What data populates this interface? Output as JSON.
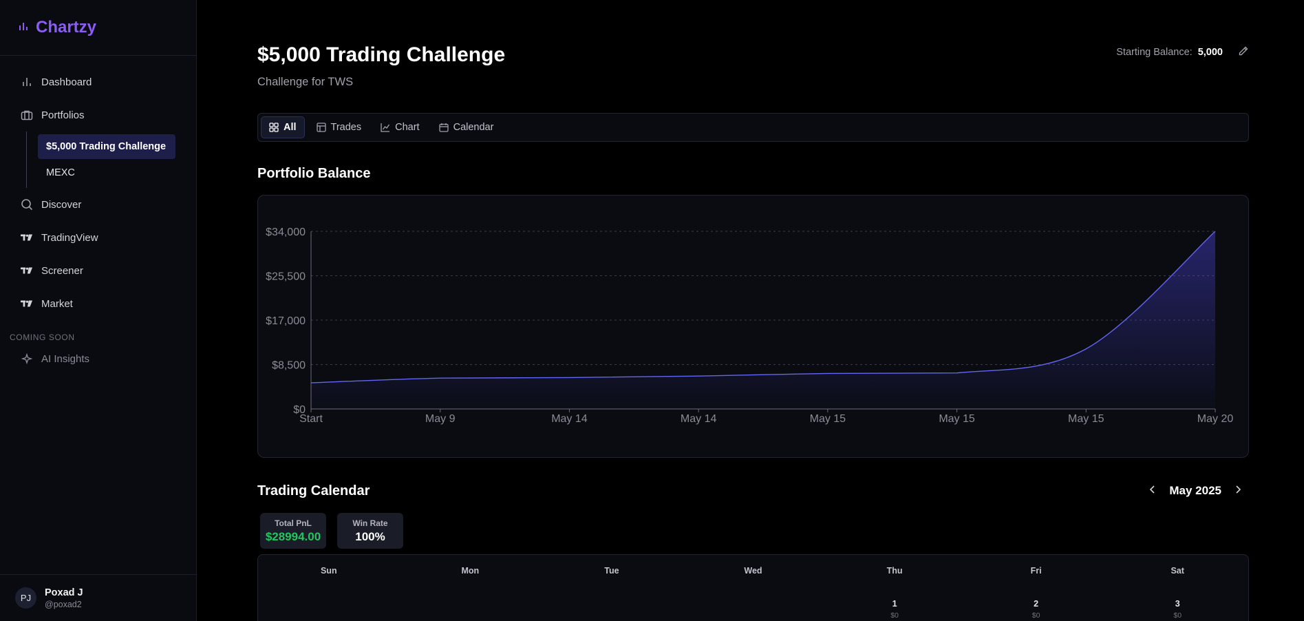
{
  "app": {
    "name": "Chartzy"
  },
  "sidebar": {
    "items": [
      {
        "label": "Dashboard",
        "icon": "bar-chart-icon"
      },
      {
        "label": "Portfolios",
        "icon": "briefcase-icon"
      },
      {
        "label": "Discover",
        "icon": "search-icon"
      },
      {
        "label": "TradingView",
        "icon": "tradingview-icon"
      },
      {
        "label": "Screener",
        "icon": "tradingview-icon"
      },
      {
        "label": "Market",
        "icon": "tradingview-icon"
      }
    ],
    "portfolios": [
      {
        "label": "$5,000 Trading Challenge",
        "active": true
      },
      {
        "label": "MEXC",
        "active": false
      }
    ],
    "coming_soon_label": "COMING SOON",
    "coming_soon_items": [
      {
        "label": "AI Insights",
        "icon": "sparkle-icon"
      }
    ]
  },
  "user": {
    "initials": "PJ",
    "name": "Poxad J",
    "handle": "@poxad2"
  },
  "header": {
    "title": "$5,000 Trading Challenge",
    "subtitle": "Challenge for TWS",
    "starting_balance_label": "Starting Balance:",
    "starting_balance_value": "5,000"
  },
  "tabs": [
    {
      "label": "All",
      "icon": "grid-icon",
      "active": true
    },
    {
      "label": "Trades",
      "icon": "table-icon",
      "active": false
    },
    {
      "label": "Chart",
      "icon": "line-chart-icon",
      "active": false
    },
    {
      "label": "Calendar",
      "icon": "calendar-icon",
      "active": false
    }
  ],
  "balance_section": {
    "title": "Portfolio Balance"
  },
  "chart_data": {
    "type": "area",
    "x": [
      "Start",
      "May 9",
      "May 14",
      "May 14",
      "May 15",
      "May 15",
      "May 15",
      "May 20"
    ],
    "values": [
      5000,
      5900,
      6000,
      6300,
      6800,
      6900,
      11500,
      34000
    ],
    "ytick_labels": [
      "$0",
      "$8,500",
      "$17,000",
      "$25,500",
      "$34,000"
    ],
    "ylim": [
      0,
      34000
    ],
    "grid": true,
    "color": "#6366f1"
  },
  "calendar": {
    "title": "Trading Calendar",
    "month": "May 2025",
    "total_pnl_label": "Total PnL",
    "total_pnl_value": "$28994.00",
    "win_rate_label": "Win Rate",
    "win_rate_value": "100%",
    "weekdays": [
      "Sun",
      "Mon",
      "Tue",
      "Wed",
      "Thu",
      "Fri",
      "Sat"
    ],
    "first_row": [
      {
        "day": "",
        "pnl": ""
      },
      {
        "day": "",
        "pnl": ""
      },
      {
        "day": "",
        "pnl": ""
      },
      {
        "day": "",
        "pnl": ""
      },
      {
        "day": "1",
        "pnl": "$0"
      },
      {
        "day": "2",
        "pnl": "$0"
      },
      {
        "day": "3",
        "pnl": "$0"
      }
    ]
  }
}
